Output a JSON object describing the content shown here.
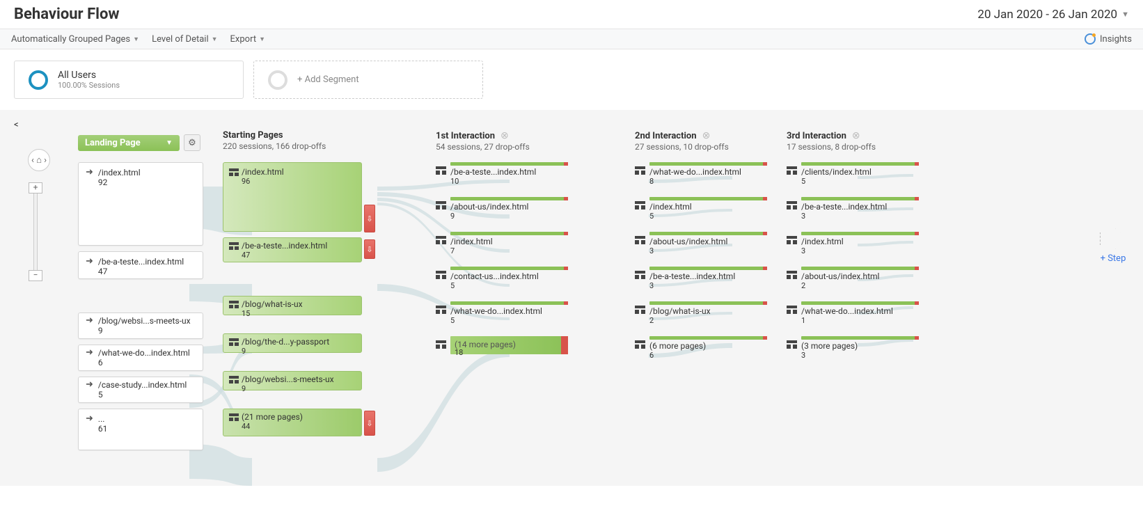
{
  "page_title": "Behaviour Flow",
  "date_range": "20 Jan 2020 - 26 Jan 2020",
  "toolbar": {
    "grouped": "Automatically Grouped Pages",
    "level": "Level of Detail",
    "export": "Export",
    "insights": "Insights"
  },
  "segments": {
    "all_users_title": "All Users",
    "all_users_sub": "100.00% Sessions",
    "add_segment": "+ Add Segment"
  },
  "landing_dropdown": "Landing Page",
  "columns": {
    "starting": {
      "title": "Starting Pages",
      "sub": "220 sessions, 166 drop-offs"
    },
    "int1": {
      "title": "1st Interaction",
      "sub": "54 sessions, 27 drop-offs"
    },
    "int2": {
      "title": "2nd Interaction",
      "sub": "27 sessions, 10 drop-offs"
    },
    "int3": {
      "title": "3rd Interaction",
      "sub": "17 sessions, 8 drop-offs"
    }
  },
  "landing_nodes": [
    {
      "label": "/index.html",
      "count": "92",
      "size": "big"
    },
    {
      "label": "/be-a-teste...index.html",
      "count": "47",
      "size": "med"
    },
    {
      "label": "/blog/websi...s-meets-ux",
      "count": "9",
      "size": "small"
    },
    {
      "label": "/what-we-do...index.html",
      "count": "6",
      "size": "small"
    },
    {
      "label": "/case-study...index.html",
      "count": "5",
      "size": "small"
    },
    {
      "label": "...",
      "count": "61",
      "size": "med"
    }
  ],
  "starting_nodes": [
    {
      "label": "/index.html",
      "count": "96",
      "tall": true,
      "drop": true
    },
    {
      "label": "/be-a-teste...index.html",
      "count": "47",
      "drop": true
    },
    {
      "label": "/blog/what-is-ux",
      "count": "15"
    },
    {
      "label": "/blog/the-d...y-passport",
      "count": "9"
    },
    {
      "label": "/blog/websi...s-meets-ux",
      "count": "9"
    },
    {
      "label": "(21 more pages)",
      "count": "44",
      "drop": true
    }
  ],
  "int1_nodes": [
    {
      "label": "/be-a-teste...index.html",
      "count": "10"
    },
    {
      "label": "/about-us/index.html",
      "count": "9"
    },
    {
      "label": "/index.html",
      "count": "7"
    },
    {
      "label": "/contact-us...index.html",
      "count": "5"
    },
    {
      "label": "/what-we-do...index.html",
      "count": "5"
    },
    {
      "label": "(14 more pages)",
      "count": "18",
      "more": true
    }
  ],
  "int2_nodes": [
    {
      "label": "/what-we-do...index.html",
      "count": "8"
    },
    {
      "label": "/index.html",
      "count": "5"
    },
    {
      "label": "/about-us/index.html",
      "count": "3"
    },
    {
      "label": "/be-a-teste...index.html",
      "count": "3"
    },
    {
      "label": "/blog/what-is-ux",
      "count": "2"
    },
    {
      "label": "(6 more pages)",
      "count": "6"
    }
  ],
  "int3_nodes": [
    {
      "label": "/clients/index.html",
      "count": "5"
    },
    {
      "label": "/be-a-teste...index.html",
      "count": "3"
    },
    {
      "label": "/index.html",
      "count": "3"
    },
    {
      "label": "/about-us/index.html",
      "count": "2"
    },
    {
      "label": "/what-we-do...index.html",
      "count": "1"
    },
    {
      "label": "(3 more pages)",
      "count": "3"
    }
  ],
  "add_step": "+ Step"
}
